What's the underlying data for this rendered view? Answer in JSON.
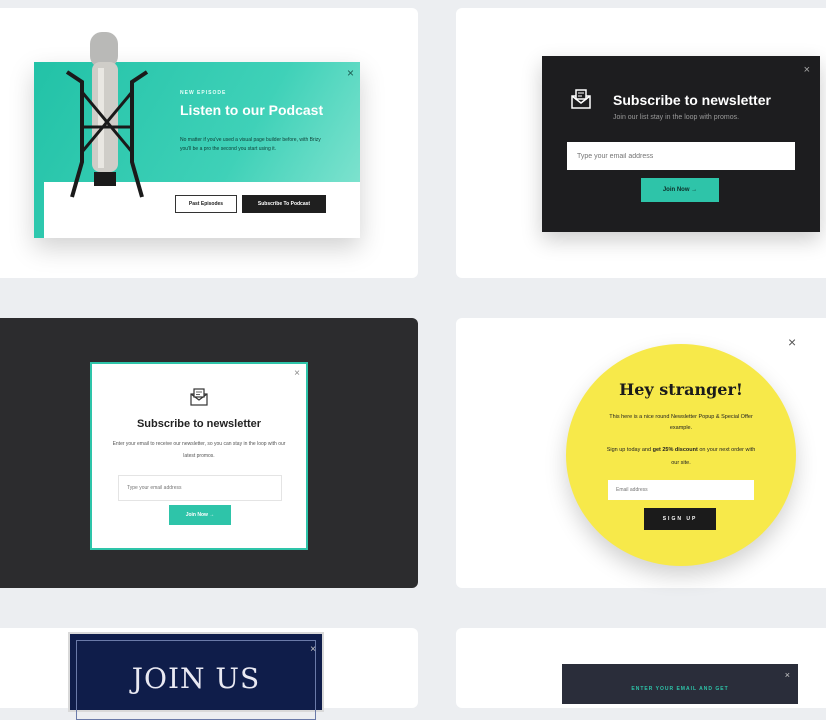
{
  "podcast": {
    "eyebrow": "NEW EPISODE",
    "title": "Listen to our Podcast",
    "body": "No matter if you've used a visual page builder before, with Brizy you'll be a pro the second you start using it.",
    "btn_past": "Past Episodes",
    "btn_subscribe": "Subscribe To Podcast",
    "close": "×"
  },
  "newsletter_dark": {
    "title": "Subscribe to newsletter",
    "subtitle": "Join our list stay in the loop with promos.",
    "placeholder": "Type your email address",
    "button": "Join Now →",
    "close": "×"
  },
  "newsletter_white": {
    "title": "Subscribe to newsletter",
    "body": "Enter your email to receive our newsletter, so you can stay in the loop with our latest promos.",
    "placeholder": "Type your email address",
    "button": "Join Now →",
    "close": "×"
  },
  "yellow": {
    "title": "Hey stranger!",
    "body1": "This here is a nice round Newsletter Popup & Special Offer example.",
    "body2_pre": "Sign up today and ",
    "body2_bold": "get 25% discount",
    "body2_post": " on your next order with our site.",
    "placeholder": "Email address",
    "button": "SIGN UP",
    "close": "×"
  },
  "join": {
    "title": "JOIN US",
    "close": "×"
  },
  "enter": {
    "label": "ENTER YOUR EMAIL AND GET",
    "close": "×"
  },
  "colors": {
    "teal": "#2ec4a9",
    "dark": "#1d1d1f",
    "yellow": "#f7e94a",
    "navy": "#0f1d4a"
  }
}
